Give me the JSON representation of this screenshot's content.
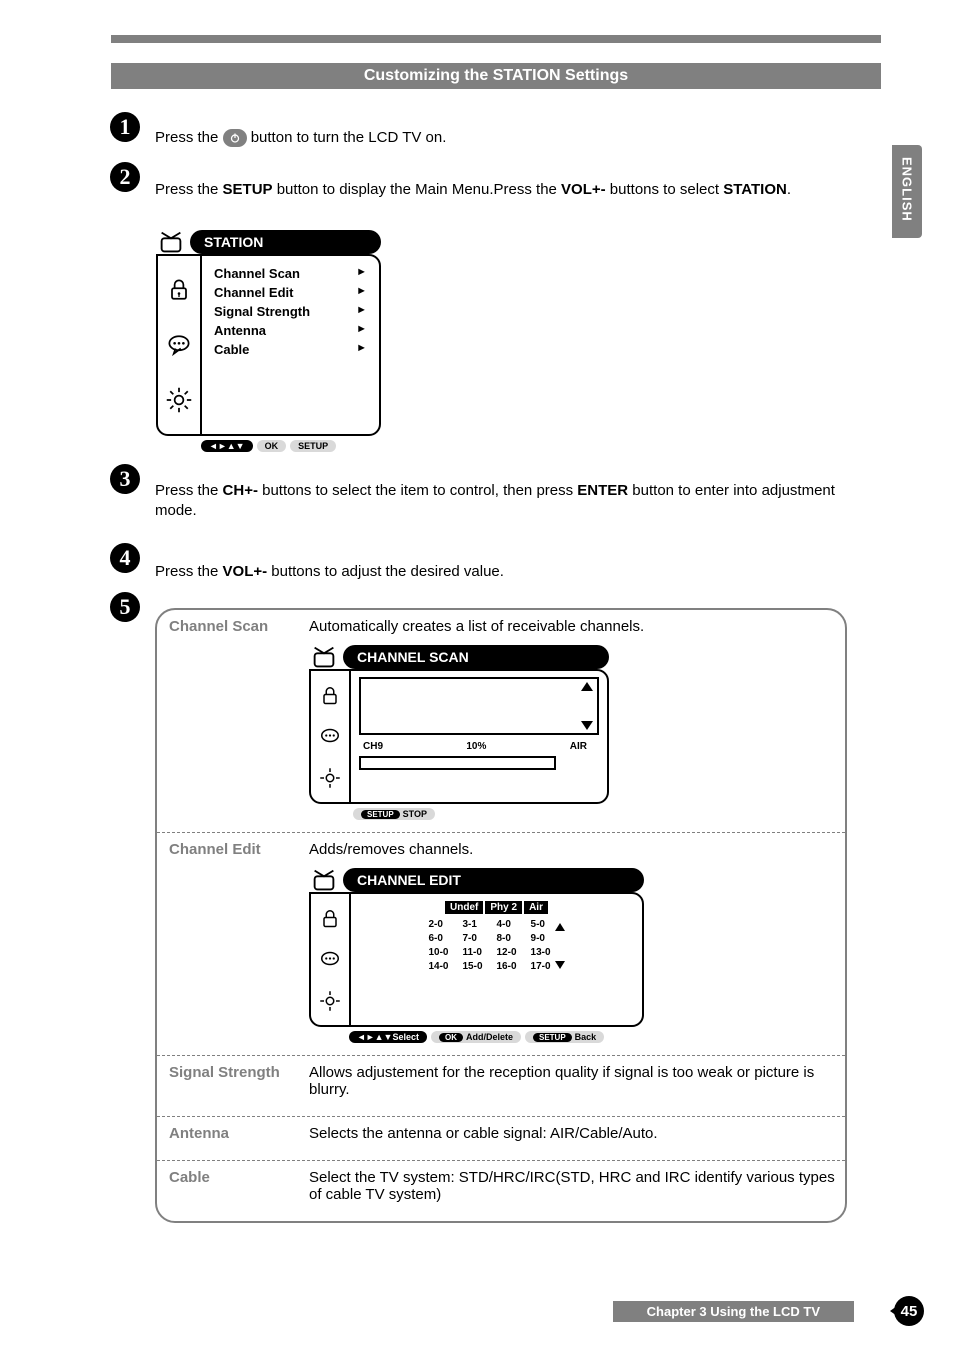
{
  "side_tab": "ENGLISH",
  "header": "Customizing the STATION Settings",
  "steps": {
    "s1": {
      "num": "1",
      "pre": "Press the ",
      "post": " button to turn the LCD TV on."
    },
    "s2": {
      "num": "2",
      "text_parts": [
        "Press the ",
        "SETUP",
        " button to display the Main Menu.Press the ",
        "VOL+-",
        " buttons to select ",
        "STATION",
        "."
      ]
    },
    "s3": {
      "num": "3",
      "text_parts": [
        "Press the ",
        "CH+-",
        " buttons to select the item to control, then press ",
        "ENTER",
        " button to enter into adjustment mode."
      ]
    },
    "s4": {
      "num": "4",
      "text_parts": [
        "Press the ",
        "VOL+-",
        " buttons to adjust the desired value."
      ]
    },
    "s5": {
      "num": "5"
    }
  },
  "station_osd": {
    "title": "STATION",
    "items": [
      "Channel Scan",
      "Channel Edit",
      "Signal Strength",
      "Antenna",
      "Cable"
    ],
    "nav_arrows": "◄►▲▼",
    "btn_ok": "OK",
    "btn_setup": "SETUP"
  },
  "table": {
    "channel_scan": {
      "label": "Channel Scan",
      "desc": "Automatically creates a list of receivable channels.",
      "osd_title": "CHANNEL SCAN",
      "ch": "CH9",
      "pct": "10%",
      "src": "AIR",
      "btn_setup": "SETUP",
      "btn_stop": "STOP"
    },
    "channel_edit": {
      "label": "Channel Edit",
      "desc": "Adds/removes channels.",
      "osd_title": "CHANNEL EDIT",
      "tags": [
        "Undef",
        "Phy 2",
        "Air"
      ],
      "grid": [
        "2-0",
        "3-1",
        "4-0",
        "5-0",
        "6-0",
        "7-0",
        "8-0",
        "9-0",
        "10-0",
        "11-0",
        "12-0",
        "13-0",
        "14-0",
        "15-0",
        "16-0",
        "17-0"
      ],
      "nav_select": "◄►▲▼Select",
      "btn_ok": "OK",
      "btn_add": "Add/Delete",
      "btn_setup": "SETUP",
      "btn_back": "Back"
    },
    "signal_strength": {
      "label": "Signal Strength",
      "desc": "Allows adjustement for the reception quality if signal is too weak or picture is blurry."
    },
    "antenna": {
      "label": "Antenna",
      "desc": "Selects the antenna or cable signal: AIR/Cable/Auto."
    },
    "cable": {
      "label": "Cable",
      "desc": "Select the TV system: STD/HRC/IRC(STD, HRC and IRC identify various types of cable TV system)"
    }
  },
  "footer": {
    "chapter": "Chapter 3 Using the LCD TV",
    "page": "45"
  }
}
